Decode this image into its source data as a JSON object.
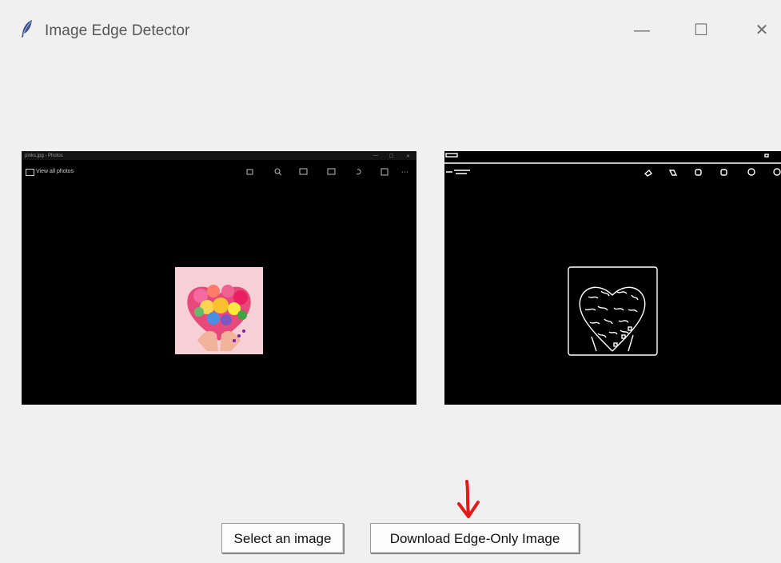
{
  "window": {
    "title": "Image Edge Detector",
    "minimize_glyph": "—",
    "maximize_glyph": "☐",
    "close_glyph": "✕",
    "app_icon": "feather-icon"
  },
  "left_image": {
    "photos_window_title": "pinks.jpg - Photos",
    "view_all_label": "View all photos"
  },
  "buttons": {
    "select_label": "Select an image",
    "download_label": "Download Edge-Only Image"
  },
  "annotation": {
    "arrow_color": "#e21a1a"
  }
}
